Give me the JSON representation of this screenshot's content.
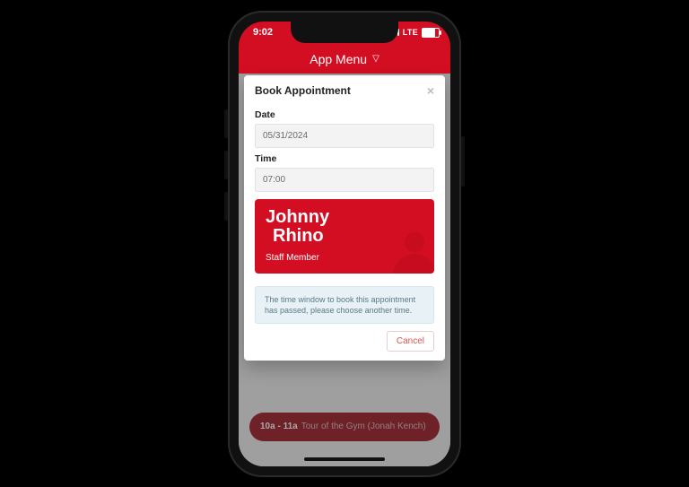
{
  "statusbar": {
    "time": "9:02",
    "network_label": "LTE"
  },
  "appbar": {
    "title": "App Menu",
    "dropdown_glyph": "▽"
  },
  "modal": {
    "title": "Book Appointment",
    "close_glyph": "×",
    "date_label": "Date",
    "date_value": "05/31/2024",
    "time_label": "Time",
    "time_value": "07:00",
    "staff_name_line1": "Johnny",
    "staff_name_line2": "Rhino",
    "staff_role": "Staff Member",
    "alert_text": "The time window to book this appointment has passed, please choose another time.",
    "cancel_label": "Cancel"
  },
  "background_event": {
    "time_range": "10a - 11a",
    "title": "Tour of the Gym (Jonah Kench)"
  },
  "colors": {
    "brand_red": "#d40e22",
    "alert_bg": "#e8f1f5"
  }
}
